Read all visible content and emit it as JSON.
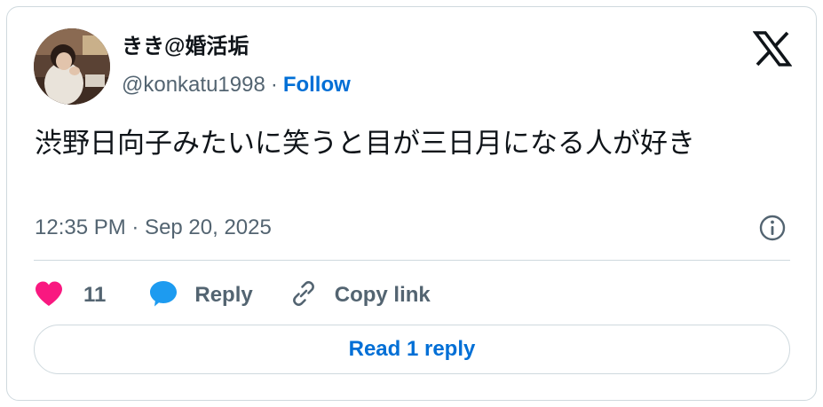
{
  "author": {
    "display_name": "きき@婚活垢",
    "handle": "@konkatu1998",
    "separator": "·",
    "follow_label": "Follow"
  },
  "tweet": {
    "text": "渋野日向子みたいに笑うと目が三日月になる人が好き",
    "timestamp": "12:35 PM · Sep 20, 2025"
  },
  "actions": {
    "like_count": "11",
    "reply_label": "Reply",
    "copy_link_label": "Copy link"
  },
  "footer": {
    "read_replies_label": "Read 1 reply"
  },
  "icons": {
    "brand": "x-logo-icon",
    "info": "info-icon",
    "like": "heart-icon",
    "reply": "speech-bubble-icon",
    "copy": "link-icon"
  },
  "colors": {
    "like": "#f91880",
    "reply": "#1d9bf0",
    "link_blue": "#006fd6",
    "secondary_text": "#536471",
    "border": "#cfd9de"
  }
}
